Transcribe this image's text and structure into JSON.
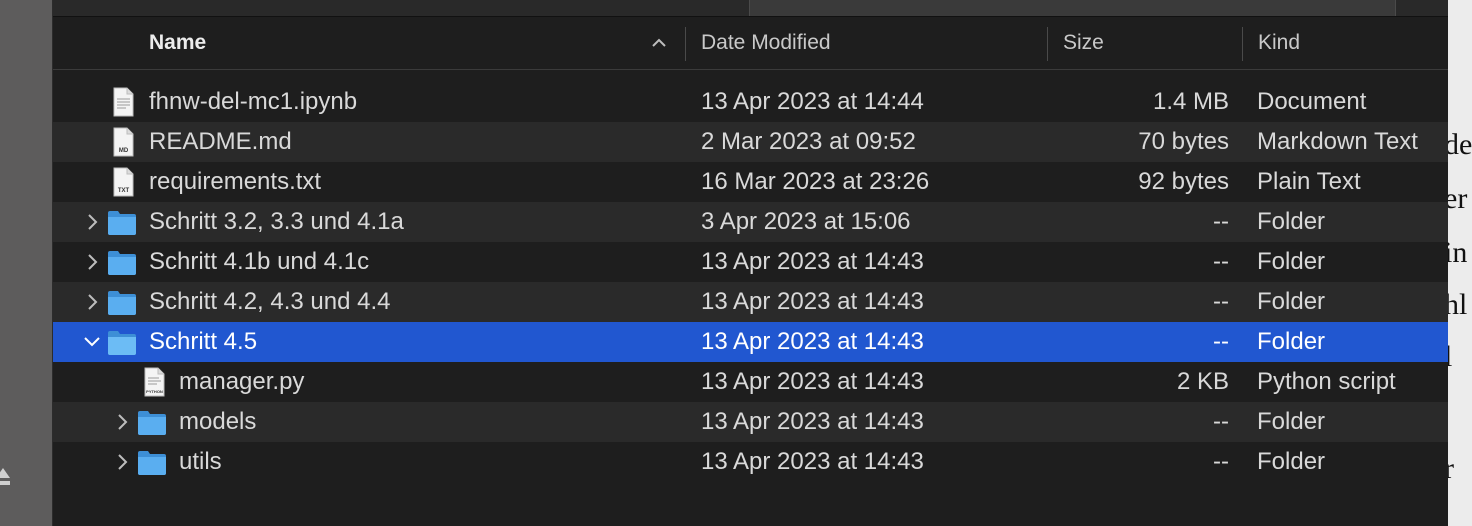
{
  "window": {
    "columns": {
      "name": "Name",
      "date_modified": "Date Modified",
      "size": "Size",
      "kind": "Kind"
    },
    "files": [
      {
        "name": "fhnw-del-mc1.ipynb",
        "date": "13 Apr 2023 at 14:44",
        "size": "1.4 MB",
        "kind": "Document",
        "icon": "document-icon",
        "icon_label": ""
      },
      {
        "name": "README.md",
        "date": "2 Mar 2023 at 09:52",
        "size": "70 bytes",
        "kind": "Markdown Text",
        "icon": "md-file-icon",
        "icon_label": "MD"
      },
      {
        "name": "requirements.txt",
        "date": "16 Mar 2023 at 23:26",
        "size": "92 bytes",
        "kind": "Plain Text",
        "icon": "txt-file-icon",
        "icon_label": "TXT"
      },
      {
        "name": "Schritt 3.2, 3.3 und 4.1a",
        "date": "3 Apr 2023 at 15:06",
        "size": "--",
        "kind": "Folder",
        "icon": "folder-icon"
      },
      {
        "name": "Schritt 4.1b und 4.1c",
        "date": "13 Apr 2023 at 14:43",
        "size": "--",
        "kind": "Folder",
        "icon": "folder-icon"
      },
      {
        "name": "Schritt 4.2, 4.3 und 4.4",
        "date": "13 Apr 2023 at 14:43",
        "size": "--",
        "kind": "Folder",
        "icon": "folder-icon"
      },
      {
        "name": "Schritt 4.5",
        "date": "13 Apr 2023 at 14:43",
        "size": "--",
        "kind": "Folder",
        "icon": "folder-icon",
        "selected": true,
        "expanded": true
      },
      {
        "name": "manager.py",
        "date": "13 Apr 2023 at 14:43",
        "size": "2 KB",
        "kind": "Python script",
        "icon": "python-file-icon",
        "icon_label": "PYTHON"
      },
      {
        "name": "models",
        "date": "13 Apr 2023 at 14:43",
        "size": "--",
        "kind": "Folder",
        "icon": "folder-icon"
      },
      {
        "name": "utils",
        "date": "13 Apr 2023 at 14:43",
        "size": "--",
        "kind": "Folder",
        "icon": "folder-icon"
      }
    ]
  },
  "background_text": [
    "de",
    "er",
    "in",
    "hl",
    "l",
    "r"
  ],
  "colors": {
    "selection": "#2157d0",
    "folder": "#5aaef0",
    "window_bg": "#1e1e1e",
    "alt_row": "#2a2a2a"
  }
}
